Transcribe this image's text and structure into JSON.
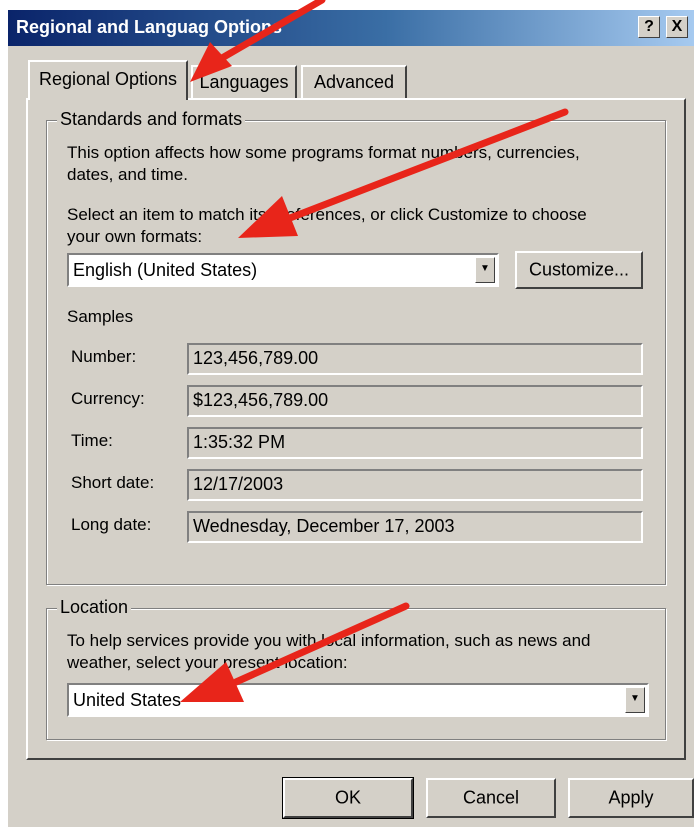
{
  "window": {
    "title": "Regional and Languag Options",
    "help_glyph": "?",
    "close_glyph": "X"
  },
  "tabs": [
    {
      "label": "Regional Options",
      "selected": true
    },
    {
      "label": "Languages",
      "selected": false
    },
    {
      "label": "Advanced",
      "selected": false
    }
  ],
  "standards": {
    "legend": "Standards and formats",
    "description_line1": "This option affects how some programs format numbers, currencies,",
    "description_line2": "dates, and time.",
    "select_line1": "Select an item to match its preferences, or click Customize to choose",
    "select_line2": "your own formats:",
    "selected_locale": "English (United States)",
    "customize_label": "Customize..."
  },
  "samples": {
    "label": "Samples",
    "rows": [
      {
        "label": "Number:",
        "value": "123,456,789.00"
      },
      {
        "label": "Currency:",
        "value": "$123,456,789.00"
      },
      {
        "label": "Time:",
        "value": "1:35:32 PM"
      },
      {
        "label": "Short date:",
        "value": "12/17/2003"
      },
      {
        "label": "Long date:",
        "value": "Wednesday, December 17, 2003"
      }
    ]
  },
  "location": {
    "legend": "Location",
    "description_line1": "To help services provide you with local information, such as news and",
    "description_line2": "weather, select your present location:",
    "selected": "United States"
  },
  "footer": {
    "ok_label": "OK",
    "cancel_label": "Cancel",
    "apply_label": "Apply"
  },
  "colors": {
    "dialog_face": "#d4d0c8",
    "title_gradient_start": "#0a246a",
    "annotation_arrow": "#e8251a"
  }
}
